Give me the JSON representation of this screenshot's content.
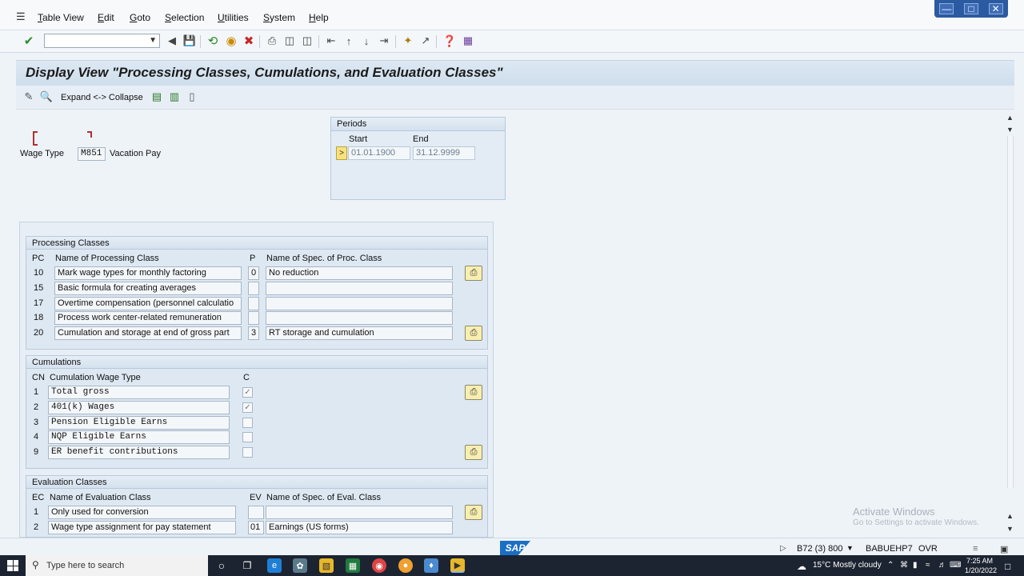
{
  "menu": {
    "items": [
      "Table View",
      "Edit",
      "Goto",
      "Selection",
      "Utilities",
      "System",
      "Help"
    ]
  },
  "title": "Display View \"Processing Classes, Cumulations, and Evaluation Classes\"",
  "app_toolbar": {
    "expand_label": "Expand <-> Collapse"
  },
  "wage_type": {
    "label": "Wage Type",
    "code": "M851",
    "name": "Vacation Pay"
  },
  "periods": {
    "title": "Periods",
    "start_label": "Start",
    "end_label": "End",
    "sel": ">",
    "start": "01.01.1900",
    "end": "31.12.9999"
  },
  "processing": {
    "title": "Processing Classes",
    "col_pc": "PC",
    "col_name": "Name of Processing Class",
    "col_p": "P",
    "col_spec": "Name of Spec. of Proc. Class",
    "rows": [
      {
        "pc": "10",
        "name": "Mark wage types for monthly factoring",
        "p": "0",
        "spec": "No reduction"
      },
      {
        "pc": "15",
        "name": "Basic formula for creating averages",
        "p": "",
        "spec": ""
      },
      {
        "pc": "17",
        "name": "Overtime compensation (personnel calculatio",
        "p": "",
        "spec": ""
      },
      {
        "pc": "18",
        "name": "Process work center-related remuneration",
        "p": "",
        "spec": ""
      },
      {
        "pc": "20",
        "name": "Cumulation and storage at end of gross part",
        "p": "3",
        "spec": "RT storage and cumulation"
      }
    ]
  },
  "cumulations": {
    "title": "Cumulations",
    "col_cn": "CN",
    "col_name": "Cumulation Wage Type",
    "col_c": "C",
    "rows": [
      {
        "cn": "1",
        "name": "Total gross",
        "checked": true
      },
      {
        "cn": "2",
        "name": "401(k) Wages",
        "checked": true
      },
      {
        "cn": "3",
        "name": "Pension Eligible Earns",
        "checked": false
      },
      {
        "cn": "4",
        "name": "NQP Eligible Earns",
        "checked": false
      },
      {
        "cn": "9",
        "name": "ER benefit contributions",
        "checked": false
      }
    ]
  },
  "evaluation": {
    "title": "Evaluation Classes",
    "col_ec": "EC",
    "col_name": "Name of Evaluation Class",
    "col_ev": "EV",
    "col_spec": "Name of Spec. of Eval. Class",
    "rows": [
      {
        "ec": "1",
        "name": "Only used for conversion",
        "ev": "",
        "spec": ""
      },
      {
        "ec": "2",
        "name": "Wage type assignment for pay statement",
        "ev": "01",
        "spec": "Earnings (US forms)"
      }
    ]
  },
  "watermark": {
    "line1": "Activate Windows",
    "line2": "Go to Settings to activate Windows."
  },
  "statusbar": {
    "logo": "SAP",
    "system": "B72 (3) 800",
    "server": "BABUEHP7",
    "mode": "OVR"
  },
  "taskbar": {
    "search_placeholder": "Type here to search",
    "weather": "15°C  Mostly cloudy",
    "time": "7:25 AM",
    "date": "1/20/2022"
  },
  "colors": {
    "title_bg": "#d4e2ef",
    "group_bg": "#dde8f2",
    "detail_btn": "#f8eeb0",
    "taskbar": "#1c2431"
  }
}
